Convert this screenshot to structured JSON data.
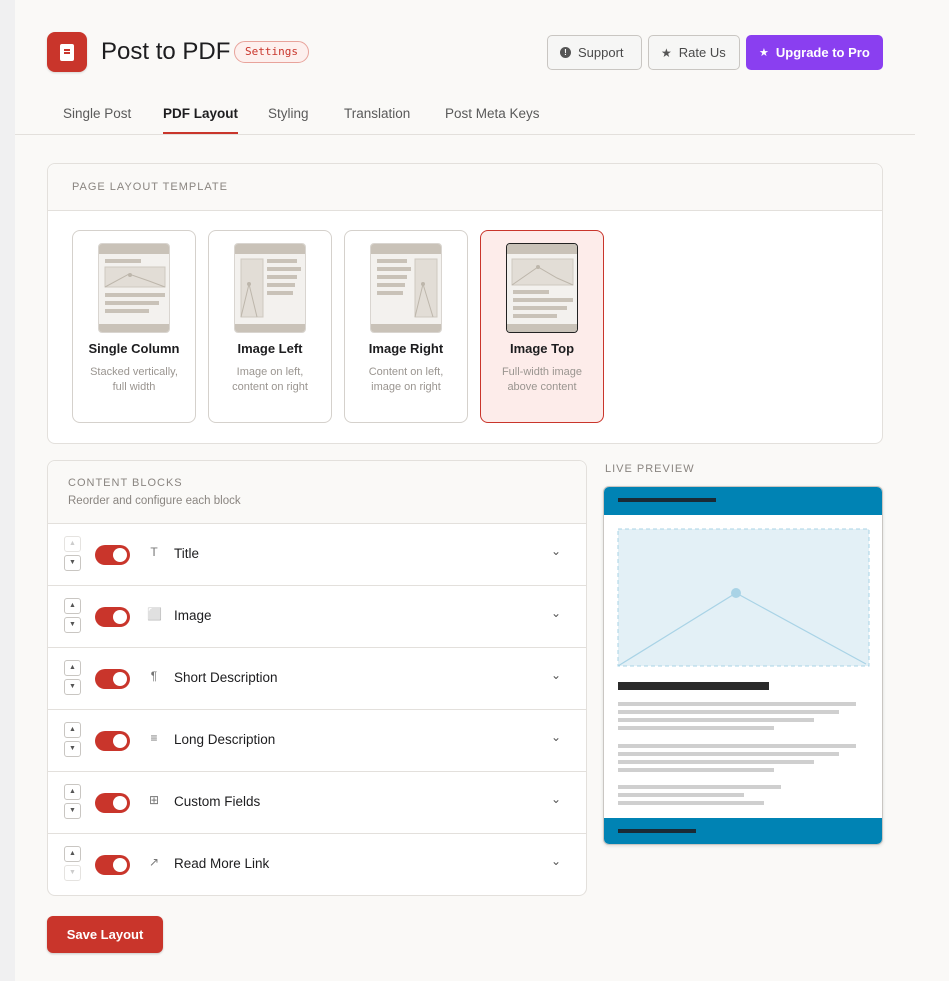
{
  "app": {
    "title": "Post to PDF",
    "badge": "Settings"
  },
  "header": {
    "support_label": "Support",
    "rate_label": "Rate Us",
    "pro_label": "Upgrade to Pro"
  },
  "tabs": [
    {
      "label": "Single Post",
      "active": false
    },
    {
      "label": "PDF Layout",
      "active": true
    },
    {
      "label": "Styling",
      "active": false
    },
    {
      "label": "Translation",
      "active": false
    },
    {
      "label": "Post Meta Keys",
      "active": false
    }
  ],
  "template_section": {
    "label": "PAGE LAYOUT TEMPLATE",
    "templates": [
      {
        "name": "Single Column",
        "desc": "Stacked vertically, full width",
        "selected": false
      },
      {
        "name": "Image Left",
        "desc": "Image on left, content on right",
        "selected": false
      },
      {
        "name": "Image Right",
        "desc": "Content on left, image on right",
        "selected": false
      },
      {
        "name": "Image Top",
        "desc": "Full-width image above content",
        "selected": true
      }
    ]
  },
  "blocks": {
    "label": "CONTENT BLOCKS",
    "subtitle": "Reorder and configure each block",
    "items": [
      {
        "label": "Title",
        "icon": "T",
        "icon_name": "text-icon",
        "enabled": true
      },
      {
        "label": "Image",
        "icon": "⬜",
        "icon_name": "image-icon",
        "enabled": true
      },
      {
        "label": "Short Description",
        "icon": "¶",
        "icon_name": "paragraph-icon",
        "enabled": true
      },
      {
        "label": "Long Description",
        "icon": "≡",
        "icon_name": "lines-icon",
        "enabled": true
      },
      {
        "label": "Custom Fields",
        "icon": "⊞",
        "icon_name": "grid-icon",
        "enabled": true
      },
      {
        "label": "Read More Link",
        "icon": "↗",
        "icon_name": "external-link-icon",
        "enabled": true
      }
    ]
  },
  "preview": {
    "label": "LIVE PREVIEW"
  },
  "save_label": "Save Layout",
  "colors": {
    "accent": "#c9352b",
    "pro": "#8a3ff0",
    "preview_header": "#0083b4",
    "preview_image": "#e3f0f6"
  }
}
